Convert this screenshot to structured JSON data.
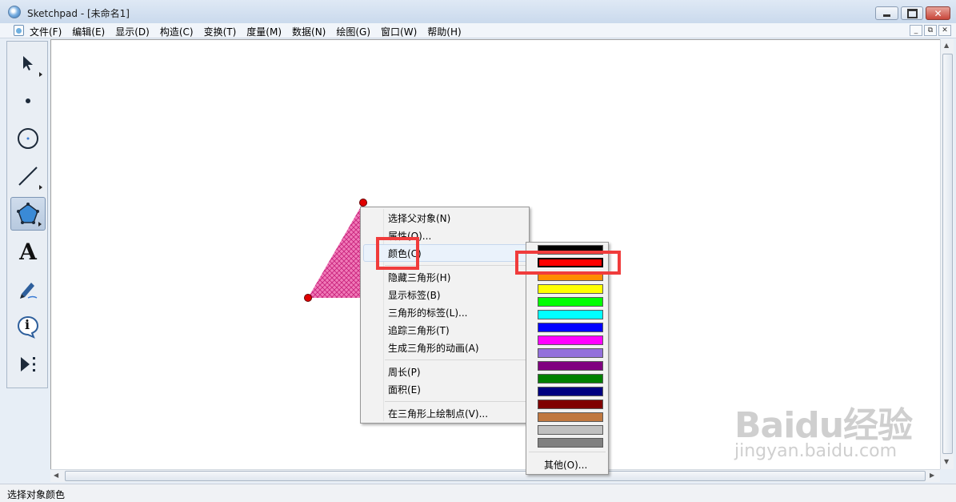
{
  "window": {
    "title": "Sketchpad  - [未命名1]",
    "close_glyph": "✕"
  },
  "menu": [
    "文件(F)",
    "编辑(E)",
    "显示(D)",
    "构造(C)",
    "变换(T)",
    "度量(M)",
    "数据(N)",
    "绘图(G)",
    "窗口(W)",
    "帮助(H)"
  ],
  "mdi": {
    "minimize": "_",
    "restore": "⧉",
    "close": "✕"
  },
  "toolbox": {
    "text_tool_glyph": "A",
    "info_tool_glyph": "i",
    "tools": [
      "arrow-select-tool",
      "point-tool",
      "compass-tool",
      "straightedge-tool",
      "polygon-tool",
      "text-tool",
      "marker-tool",
      "information-tool",
      "custom-tool"
    ]
  },
  "context_menu": {
    "items": [
      "选择父对象(N)",
      "属性(O)...",
      "颜色(C)",
      "隐藏三角形(H)",
      "显示标签(B)",
      "三角形的标签(L)...",
      "追踪三角形(T)",
      "生成三角形的动画(A)",
      "周长(P)",
      "面积(E)",
      "在三角形上绘制点(V)..."
    ]
  },
  "color_palette": {
    "colors": [
      "#000000",
      "#ff0000",
      "#ff8c00",
      "#ffff00",
      "#00ff00",
      "#00ffff",
      "#0000ff",
      "#ff00ff",
      "#9370db",
      "#800080",
      "#008000",
      "#000080",
      "#800000",
      "#c07840",
      "#c0c0c0",
      "#808080"
    ],
    "selected_color": "#ff0000",
    "other_label": "其他(O)..."
  },
  "status": {
    "text": "选择对象颜色"
  },
  "watermark": {
    "main": "Baidu经验",
    "sub": "jingyan.baidu.com"
  },
  "accent_colors": {
    "annotation": "#f03c3c",
    "triangle_fill": "#e040a0",
    "vertex": "#e00000"
  }
}
